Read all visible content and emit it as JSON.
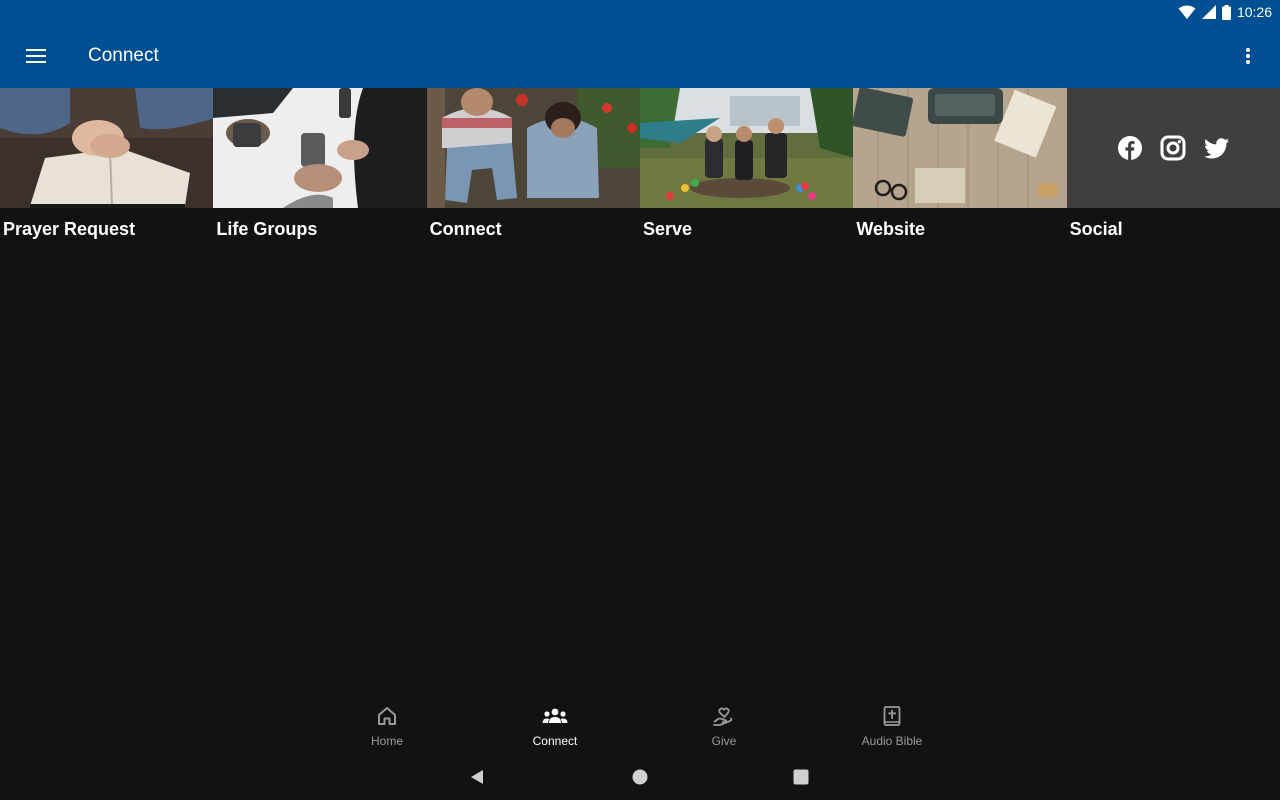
{
  "status_bar": {
    "time": "10:26"
  },
  "app_bar": {
    "title": "Connect",
    "menu_icon": "hamburger-menu-icon",
    "overflow_icon": "more-vert-icon"
  },
  "tiles": [
    {
      "label": "Prayer Request",
      "image": "hands-folded-on-open-bible-photo"
    },
    {
      "label": "Life Groups",
      "image": "people-with-coffee-mugs-photo"
    },
    {
      "label": "Connect",
      "image": "friends-sitting-outdoors-photo"
    },
    {
      "label": "Serve",
      "image": "group-sitting-on-grass-photo"
    },
    {
      "label": "Website",
      "image": "typewriter-on-wooden-desk-photo"
    },
    {
      "label": "Social",
      "icons": [
        "facebook-icon",
        "instagram-icon",
        "twitter-icon"
      ]
    }
  ],
  "bottom_nav": [
    {
      "label": "Home",
      "icon": "home-icon",
      "active": false
    },
    {
      "label": "Connect",
      "icon": "people-group-icon",
      "active": true
    },
    {
      "label": "Give",
      "icon": "heart-in-hand-icon",
      "active": false
    },
    {
      "label": "Audio Bible",
      "icon": "bible-cross-icon",
      "active": false
    }
  ],
  "system_nav": [
    "back-icon",
    "home-circle-icon",
    "recents-square-icon"
  ],
  "colors": {
    "app_bar": "#004f92",
    "background": "#121213",
    "social_tile": "#3f3f40",
    "nav_active": "#ffffff",
    "nav_inactive": "#9a9a9a"
  }
}
